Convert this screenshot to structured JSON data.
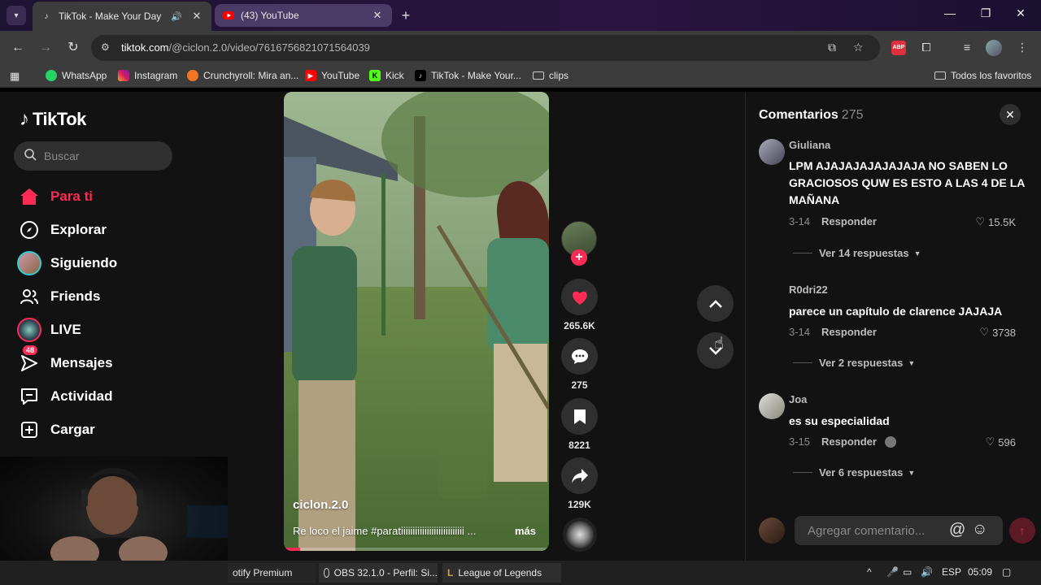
{
  "browser": {
    "tabs": [
      {
        "title": "TikTok - Make Your Day",
        "icon": "tiktok-icon",
        "active": true,
        "audio": true
      },
      {
        "title": "(43) YouTube",
        "icon": "youtube-icon",
        "active": false
      }
    ],
    "url_host": "tiktok.com",
    "url_path": "/@ciclon.2.0/video/7616756821071564039",
    "bookmarks": [
      "WhatsApp",
      "Instagram",
      "Crunchyroll: Mira an...",
      "YouTube",
      "Kick",
      "TikTok - Make Your...",
      "clips"
    ],
    "all_bookmarks": "Todos los favoritos",
    "abp_label": "ABP"
  },
  "sidebar": {
    "logo": "TikTok",
    "search_placeholder": "Buscar",
    "items": [
      {
        "label": "Para ti",
        "icon": "home-icon",
        "active": true
      },
      {
        "label": "Explorar",
        "icon": "compass-icon"
      },
      {
        "label": "Siguiendo",
        "icon": "following-avatar-icon"
      },
      {
        "label": "Friends",
        "icon": "friends-icon"
      },
      {
        "label": "LIVE",
        "icon": "live-icon"
      },
      {
        "label": "Mensajes",
        "icon": "messages-icon",
        "badge": "48"
      },
      {
        "label": "Actividad",
        "icon": "activity-icon"
      },
      {
        "label": "Cargar",
        "icon": "upload-icon"
      }
    ]
  },
  "video": {
    "author": "ciclon.2.0",
    "description": "Re loco el jaime #paratiiiiiiiiiiiiiiiiiiiiiiiiiii ...",
    "more": "más",
    "progress": 0.06
  },
  "actions": {
    "likes": "265.6K",
    "comments": "275",
    "saves": "8221",
    "shares": "129K"
  },
  "comments_panel": {
    "title": "Comentarios",
    "count": "275",
    "comments": [
      {
        "user": "Giuliana",
        "text": "LPM AJAJAJAJAJAJAJA NO SABEN LO GRACIOSOS QUW ES ESTO A LAS 4 DE LA MAÑANA",
        "date": "3-14",
        "reply": "Responder",
        "likes": "15.5K",
        "view_replies": "Ver 14 respuestas"
      },
      {
        "user": "R0dri22",
        "text": "parece un capítulo de clarence JAJAJA",
        "date": "3-14",
        "reply": "Responder",
        "likes": "3738",
        "view_replies": "Ver 2 respuestas"
      },
      {
        "user": "Joa",
        "text": "es su especialidad",
        "date": "3-15",
        "reply": "Responder",
        "likes": "596",
        "view_replies": "Ver 6 respuestas"
      }
    ],
    "input_placeholder": "Agregar comentario...",
    "at_label": "@"
  },
  "taskbar": {
    "items": [
      "otify Premium",
      "OBS 32.1.0 - Perfil: Si...",
      "League of Legends"
    ],
    "language": "ESP",
    "time": "05:09"
  },
  "colors": {
    "accent": "#fe2c55",
    "background": "#121212",
    "surface": "#2f2f2f"
  }
}
